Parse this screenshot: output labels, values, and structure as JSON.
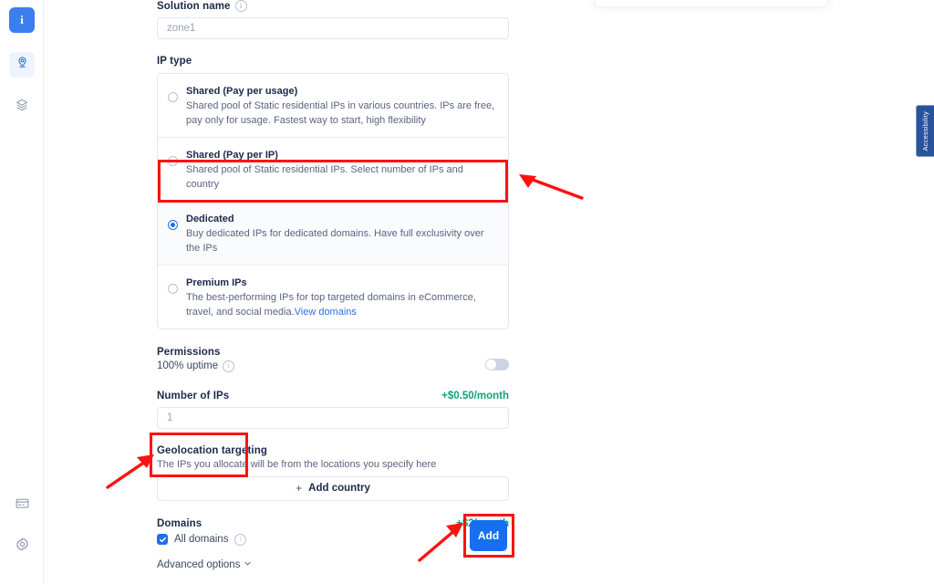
{
  "sidebar": {
    "items": [
      {
        "name": "logo",
        "icon": "info-logo-icon",
        "label": "i"
      },
      {
        "name": "proxy",
        "icon": "location-pin-icon",
        "label": ""
      },
      {
        "name": "datasets",
        "icon": "layers-icon",
        "label": ""
      },
      {
        "name": "billing",
        "icon": "credit-card-icon",
        "label": ""
      },
      {
        "name": "settings",
        "icon": "gear-icon",
        "label": ""
      }
    ]
  },
  "form": {
    "solution_name": {
      "label": "Solution name",
      "value": "zone1",
      "placeholder": "zone1"
    },
    "ip_type": {
      "label": "IP type",
      "options": [
        {
          "title": "Shared (Pay per usage)",
          "desc": "Shared pool of Static residential IPs in various countries. IPs are free, pay only for usage. Fastest way to start, high flexibility",
          "selected": false
        },
        {
          "title": "Shared (Pay per IP)",
          "desc": "Shared pool of Static residential IPs. Select number of IPs and country",
          "selected": false
        },
        {
          "title": "Dedicated",
          "desc": "Buy dedicated IPs for dedicated domains. Have full exclusivity over the IPs",
          "selected": true
        },
        {
          "title": "Premium IPs",
          "desc": "The best-performing IPs for top targeted domains in eCommerce, travel, and social media.",
          "link": "View domains",
          "selected": false
        }
      ]
    },
    "permissions": {
      "label": "Permissions",
      "uptime_label": "100% uptime",
      "toggle_on": false
    },
    "number_of_ips": {
      "label": "Number of IPs",
      "price": "+$0.50/month",
      "value": "1"
    },
    "geolocation": {
      "label": "Geolocation targeting",
      "helper": "The IPs you allocate will be from the locations you specify here",
      "button_label": "Add country",
      "button_icon": "plus-icon"
    },
    "domains": {
      "label": "Domains",
      "price": "+$2/month",
      "checkbox_label": "All domains",
      "checked": true
    },
    "advanced_options": {
      "label": "Advanced options",
      "icon": "chevron-down-icon"
    },
    "submit": {
      "label": "Add"
    }
  },
  "accessibility_tab": {
    "label": "Accessibility"
  },
  "colors": {
    "accent_blue": "#1570ef",
    "radio_blue": "#1e6fe8",
    "price_green": "#12a07a",
    "annotation_red": "#ff1111",
    "tab_blue": "#29539b"
  }
}
